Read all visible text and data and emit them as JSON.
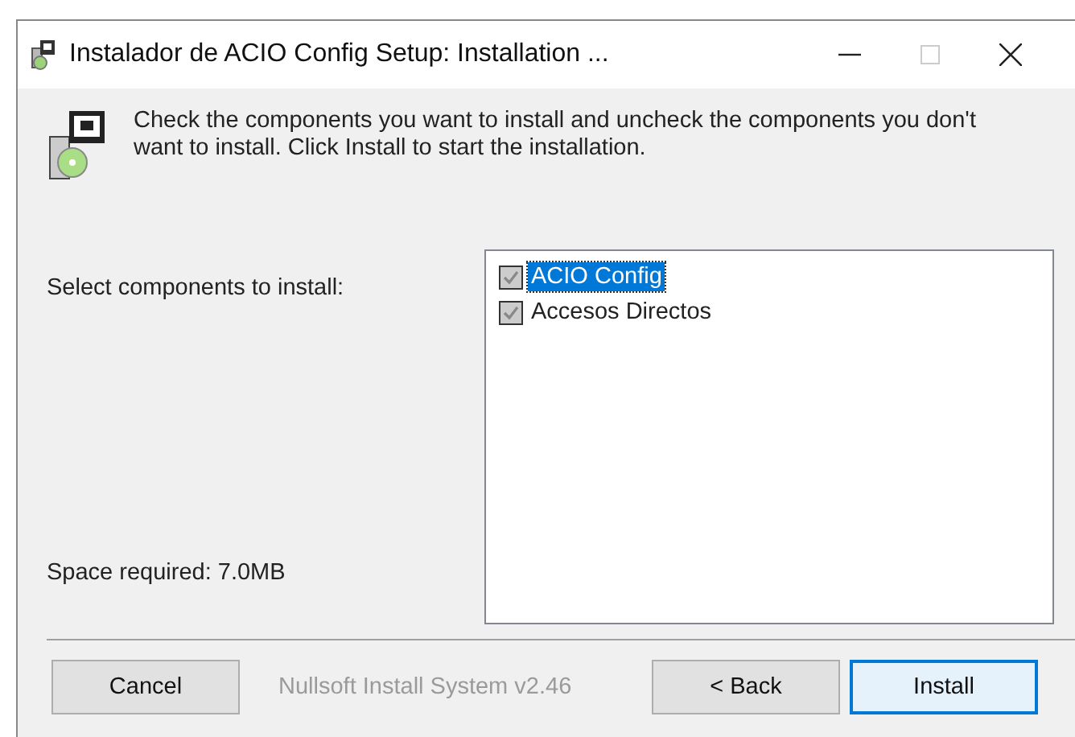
{
  "window": {
    "title": "Instalador de ACIO Config Setup: Installation ..."
  },
  "header": {
    "text": "Check the components you want to install and uncheck the components you don't want to install. Click Install to start the installation."
  },
  "components_label": "Select components to install:",
  "space_required": "Space required: 7.0MB",
  "components": [
    {
      "label": "ACIO Config",
      "checked": true,
      "disabled": true,
      "selected": true
    },
    {
      "label": "Accesos Directos",
      "checked": true,
      "disabled": true,
      "selected": false
    }
  ],
  "branding": "Nullsoft Install System v2.46",
  "buttons": [
    {
      "label": "Cancel",
      "kind": "normal"
    },
    {
      "label": "< Back",
      "kind": "normal"
    },
    {
      "label": "Install",
      "kind": "default"
    }
  ]
}
